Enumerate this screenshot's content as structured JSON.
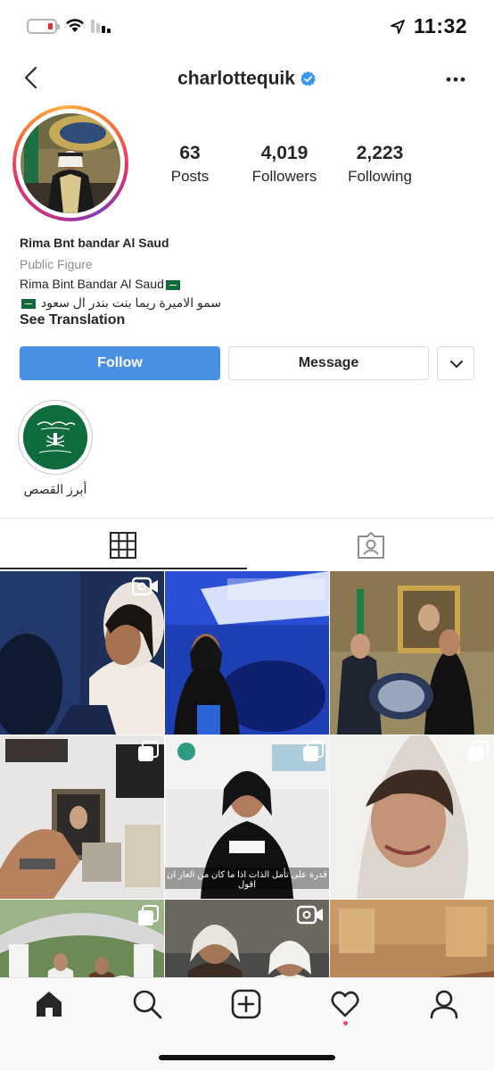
{
  "status_bar": {
    "time": "11:32"
  },
  "header": {
    "username": "charlottequik",
    "verified": true
  },
  "profile": {
    "stats": [
      {
        "value": "63",
        "label": "Posts"
      },
      {
        "value": "4,019",
        "label": "Followers"
      },
      {
        "value": "2,223",
        "label": "Following"
      }
    ],
    "display_name": "Rima Bnt bandar Al Saud",
    "category": "Public Figure",
    "bio_line1": "Rima Bint Bandar Al Saud",
    "bio_line2": "سمو الاميرة ريما بنت بندر ال سعود",
    "see_translation": "See Translation"
  },
  "actions": {
    "follow": "Follow",
    "message": "Message"
  },
  "highlights": [
    {
      "label": "أبرز القصص"
    }
  ],
  "tabs": [
    {
      "name": "grid-icon",
      "active": true
    },
    {
      "name": "tagged-icon",
      "active": false
    }
  ],
  "posts": [
    {
      "badge": "video-icon"
    },
    {
      "badge": ""
    },
    {
      "badge": ""
    },
    {
      "badge": "carousel-icon"
    },
    {
      "badge": "carousel-icon",
      "caption": "قدرة على تأمل الذات اذا ما كان من العار ان اقول"
    },
    {
      "badge": "carousel-icon"
    },
    {
      "badge": "carousel-icon"
    },
    {
      "badge": "video-icon"
    },
    {
      "badge": ""
    }
  ],
  "bottom_nav": [
    "home-icon",
    "search-icon",
    "new-post-icon",
    "activity-icon",
    "profile-icon"
  ],
  "colors": {
    "follow_button": "#4a90e2",
    "verified": "#3897f0",
    "notification_dot": "#ed4956"
  }
}
